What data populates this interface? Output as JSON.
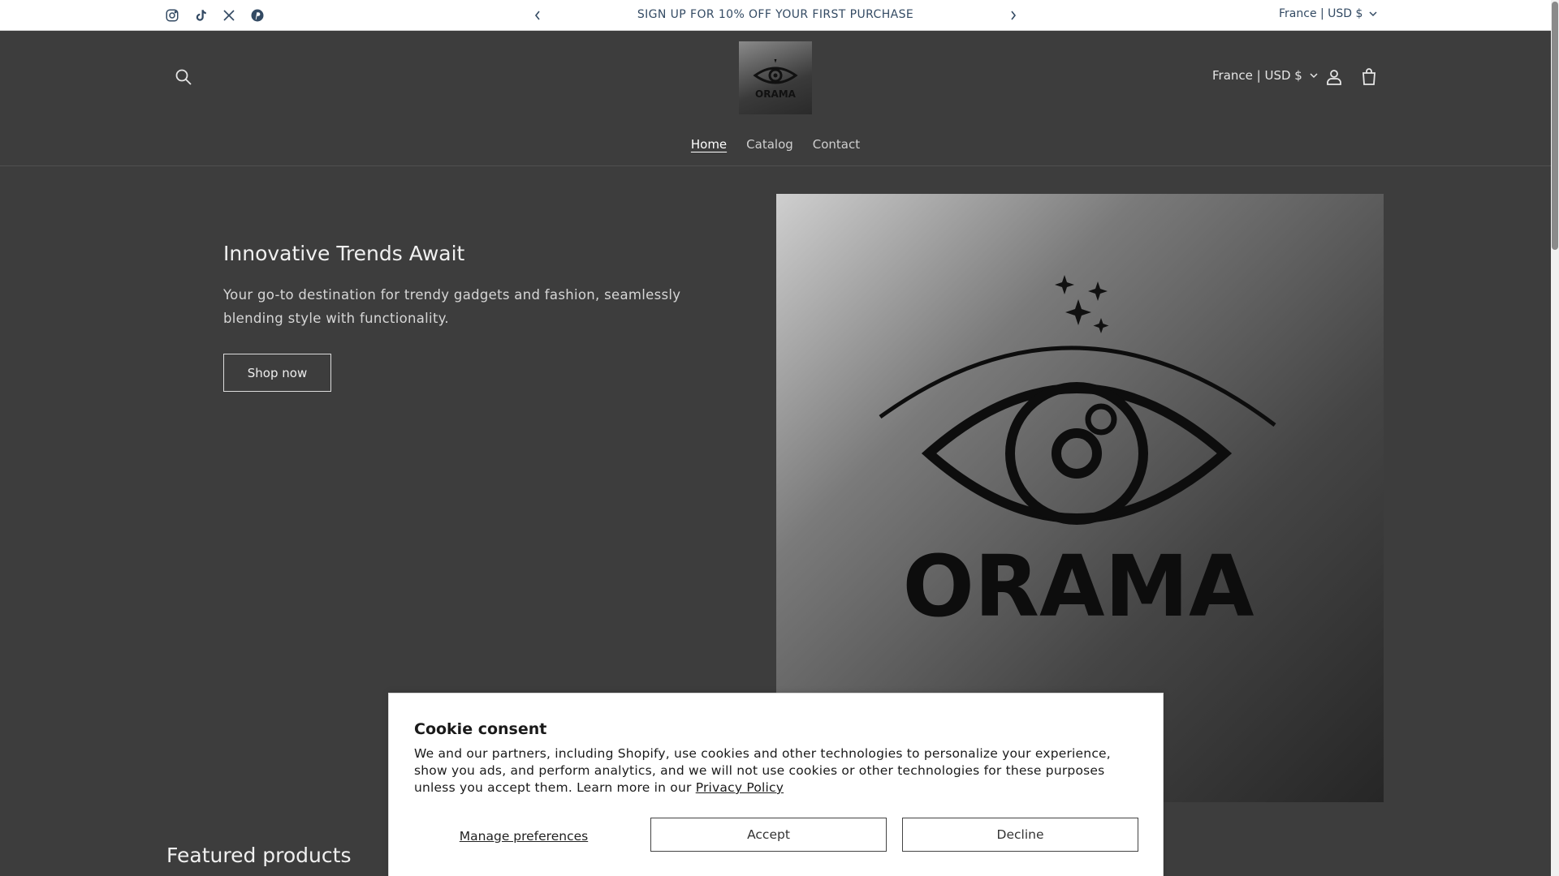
{
  "announcement": {
    "text": "SIGN UP FOR 10% OFF YOUR FIRST PURCHASE",
    "locale": "France | USD $",
    "social_icons": [
      "instagram-icon",
      "tiktok-icon",
      "x-icon",
      "pinterest-icon"
    ]
  },
  "header": {
    "logo_text": "ORAMA",
    "locale": "France | USD $",
    "nav": [
      {
        "label": "Home",
        "active": true
      },
      {
        "label": "Catalog",
        "active": false
      },
      {
        "label": "Contact",
        "active": false
      }
    ]
  },
  "hero": {
    "title": "Innovative Trends Await",
    "subtitle": "Your go-to destination for trendy gadgets and fashion, seamlessly blending style with functionality.",
    "button_label": "Shop now",
    "image_text": "ORAMA"
  },
  "featured": {
    "title": "Featured products"
  },
  "cookie": {
    "title": "Cookie consent",
    "body": "We and our partners, including Shopify, use cookies and other technologies to personalize your experience, show you ads, and perform analytics, and we will not use cookies or other technologies for these purposes unless you accept them. Learn more in our ",
    "link": "Privacy Policy",
    "manage_label": "Manage preferences",
    "accept_label": "Accept",
    "decline_label": "Decline"
  },
  "colors": {
    "background": "#3d3d3d",
    "announcement_bg": "#ffffff",
    "announcement_text": "#334a63"
  }
}
